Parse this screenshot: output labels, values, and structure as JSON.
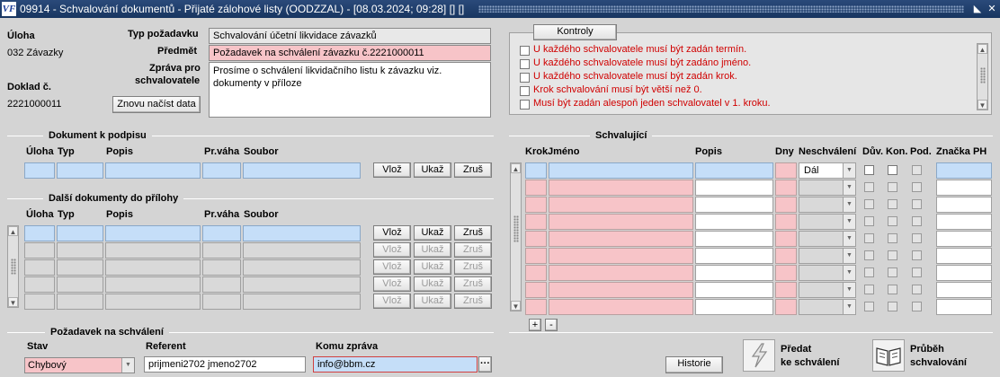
{
  "window": {
    "title": "09914 - Schvalování dokumentů - Přijaté zálohové listy (OODZZAL) - [08.03.2024; 09:28] [] []",
    "icon_text": "VF"
  },
  "header": {
    "uloha_label": "Úloha",
    "uloha_value": "032 Závazky",
    "doklad_label": "Doklad č.",
    "doklad_value": "2221000011",
    "reload_button": "Znovu načíst data",
    "typ_label": "Typ požadavku",
    "typ_value": "Schvalování účetní likvidace závazků",
    "predmet_label": "Předmět",
    "predmet_value": "Požadavek na schválení závazku č.2221000011",
    "zprava_label_1": "Zpráva pro",
    "zprava_label_2": "schvalovatele",
    "zprava_value": "Prosíme o schválení likvidačního listu k závazku viz. dokumenty v příloze"
  },
  "kontroly": {
    "button": "Kontroly",
    "items": [
      "U každého schvalovatele musí být zadán termín.",
      "U každého schvalovatele musí být zadáno jméno.",
      "U každého schvalovatele musí být zadán krok.",
      "Krok schvalování musí být větší než 0.",
      "Musí být zadán alespoň jeden schvalovatel v 1. kroku."
    ]
  },
  "dokument": {
    "section_title": "Dokument k podpisu",
    "columns": [
      "Úloha",
      "Typ",
      "Popis",
      "Pr.váha",
      "Soubor"
    ],
    "buttons": {
      "vloz": "Vlož",
      "ukaz": "Ukaž",
      "zrus": "Zruš"
    }
  },
  "dalsi": {
    "section_title": "Další dokumenty do přílohy",
    "columns": [
      "Úloha",
      "Typ",
      "Popis",
      "Pr.váha",
      "Soubor"
    ],
    "buttons": {
      "vloz": "Vlož",
      "ukaz": "Ukaž",
      "zrus": "Zruš"
    }
  },
  "schvalujici": {
    "section_title": "Schvalující",
    "columns": [
      "Krok",
      "Jméno",
      "Popis",
      "Dny",
      "Neschválení",
      "Dův.",
      "Kon.",
      "Pod.",
      "Značka PH"
    ],
    "neschvaleni_value": "Dál",
    "plus": "+",
    "minus": "-"
  },
  "pozadavek": {
    "section_title": "Požadavek na schválení",
    "stav_label": "Stav",
    "stav_value": "Chybový",
    "referent_label": "Referent",
    "referent_value": "prijmeni2702 jmeno2702",
    "komu_label": "Komu zpráva",
    "komu_value": "info@bbm.cz",
    "ellipsis": "···"
  },
  "footer": {
    "historie": "Historie",
    "predat_1": "Předat",
    "predat_2": "ke schválení",
    "prubeh_1": "Průběh",
    "prubeh_2": "schvalování"
  }
}
